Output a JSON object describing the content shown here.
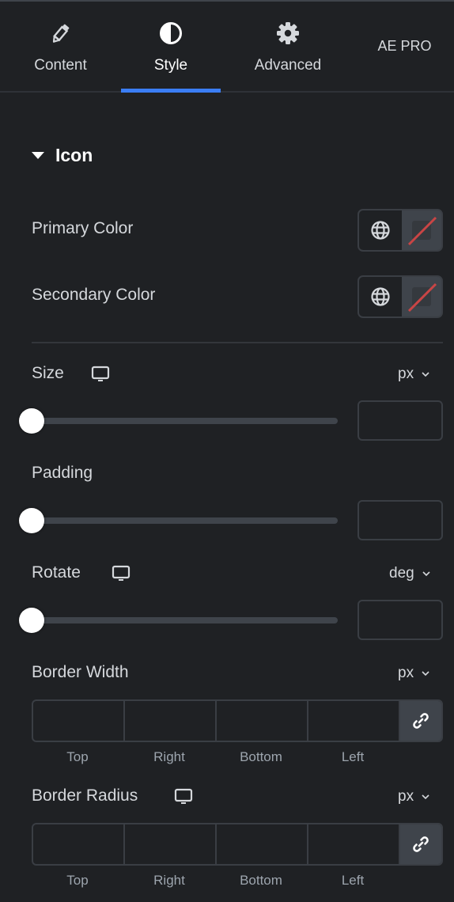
{
  "tabs": [
    {
      "label": "Content",
      "icon": "pencil-icon",
      "active": false
    },
    {
      "label": "Style",
      "icon": "half-circle-icon",
      "active": true
    },
    {
      "label": "Advanced",
      "icon": "gear-icon",
      "active": false
    },
    {
      "label": "AE PRO",
      "active": false
    }
  ],
  "accent_color": "#3b7ef5",
  "section": {
    "title": "Icon",
    "expanded": true
  },
  "colors": {
    "primary": {
      "label": "Primary Color",
      "value": null
    },
    "secondary": {
      "label": "Secondary Color",
      "value": null
    }
  },
  "size": {
    "label": "Size",
    "unit": "px",
    "value": "",
    "slider_fraction": 0
  },
  "padding": {
    "label": "Padding",
    "value": "",
    "slider_fraction": 0
  },
  "rotate": {
    "label": "Rotate",
    "unit": "deg",
    "value": "",
    "slider_fraction": 0
  },
  "border_width": {
    "label": "Border Width",
    "unit": "px",
    "fields": [
      {
        "label": "Top",
        "value": ""
      },
      {
        "label": "Right",
        "value": ""
      },
      {
        "label": "Bottom",
        "value": ""
      },
      {
        "label": "Left",
        "value": ""
      }
    ],
    "linked": true
  },
  "border_radius": {
    "label": "Border Radius",
    "unit": "px",
    "fields": [
      {
        "label": "Top",
        "value": ""
      },
      {
        "label": "Right",
        "value": ""
      },
      {
        "label": "Bottom",
        "value": ""
      },
      {
        "label": "Left",
        "value": ""
      }
    ],
    "linked": true
  }
}
